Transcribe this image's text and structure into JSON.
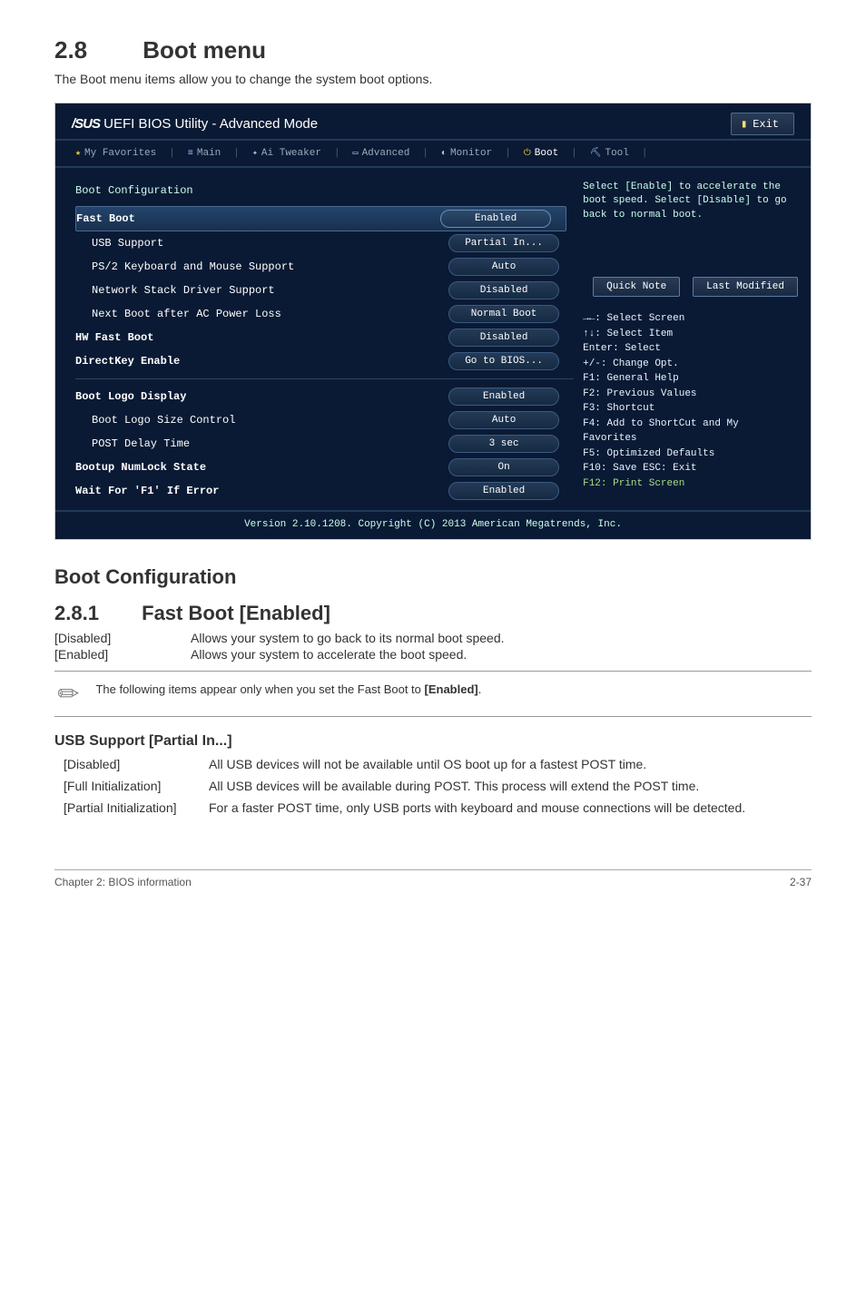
{
  "section": {
    "number": "2.8",
    "title": "Boot menu"
  },
  "intro": "The Boot menu items allow you to change the system boot options.",
  "bios": {
    "brand_prefix": "/SUS",
    "brand_rest": " UEFI BIOS Utility - Advanced Mode",
    "exit_label": "Exit",
    "tabs": {
      "favorites": "My Favorites",
      "main": "Main",
      "tweaker": "Ai Tweaker",
      "advanced": "Advanced",
      "monitor": "Monitor",
      "boot": "Boot",
      "tool": "Tool"
    },
    "config_header": "Boot Configuration",
    "items": {
      "fast_boot": {
        "label": "Fast Boot",
        "value": "Enabled"
      },
      "usb_support": {
        "label": "USB Support",
        "value": "Partial In..."
      },
      "ps2": {
        "label": "PS/2 Keyboard and Mouse Support",
        "value": "Auto"
      },
      "net_stack": {
        "label": "Network Stack Driver Support",
        "value": "Disabled"
      },
      "next_boot": {
        "label": "Next Boot after AC Power Loss",
        "value": "Normal Boot"
      },
      "hw_fast_boot": {
        "label": "HW Fast Boot",
        "value": "Disabled"
      },
      "directkey": {
        "label": "DirectKey Enable",
        "value": "Go to BIOS..."
      },
      "logo_display": {
        "label": "Boot Logo Display",
        "value": "Enabled"
      },
      "logo_size": {
        "label": "Boot Logo Size Control",
        "value": "Auto"
      },
      "post_delay": {
        "label": "POST Delay Time",
        "value": "3 sec"
      },
      "numlock": {
        "label": "Bootup NumLock State",
        "value": "On"
      },
      "wait_f1": {
        "label": "Wait For 'F1' If Error",
        "value": "Enabled"
      }
    },
    "help_text": "Select [Enable] to accelerate the boot speed. Select [Disable] to go back to normal boot.",
    "legend_buttons": {
      "quick_note": "Quick Note",
      "last_modified": "Last Modified"
    },
    "key_legend": {
      "l1": "→←: Select Screen",
      "l2": "↑↓: Select Item",
      "l3": "Enter: Select",
      "l4": "+/-: Change Opt.",
      "l5": "F1: General Help",
      "l6": "F2: Previous Values",
      "l7": "F3: Shortcut",
      "l8": "F4: Add to ShortCut and My Favorites",
      "l9": "F5: Optimized Defaults",
      "l10": "F10: Save  ESC: Exit",
      "l11": "F12: Print Screen"
    },
    "footer": "Version 2.10.1208. Copyright (C) 2013 American Megatrends, Inc."
  },
  "boot_config_heading": "Boot Configuration",
  "fast_boot_section": {
    "number": "2.8.1",
    "title": "Fast Boot [Enabled]",
    "disabled_label": "[Disabled]",
    "disabled_text": "Allows your system to go back to its normal boot speed.",
    "enabled_label": "[Enabled]",
    "enabled_text": "Allows your system to accelerate the boot speed."
  },
  "note": {
    "text_pre": "The following items appear only when you set the Fast Boot to ",
    "bold": "[Enabled]",
    "text_post": "."
  },
  "usb_section": {
    "heading": "USB Support [Partial In...]",
    "rows": {
      "disabled": {
        "k": "[Disabled]",
        "v": "All USB devices will not be available until OS boot up for a fastest POST time."
      },
      "full": {
        "k": "[Full Initialization]",
        "v": "All USB devices will be available during POST. This process will extend the POST time."
      },
      "partial": {
        "k": "[Partial Initialization]",
        "v": "For a faster POST time, only USB ports with keyboard and mouse connections will be detected."
      }
    }
  },
  "page_footer": {
    "left": "Chapter 2: BIOS information",
    "right": "2-37"
  }
}
